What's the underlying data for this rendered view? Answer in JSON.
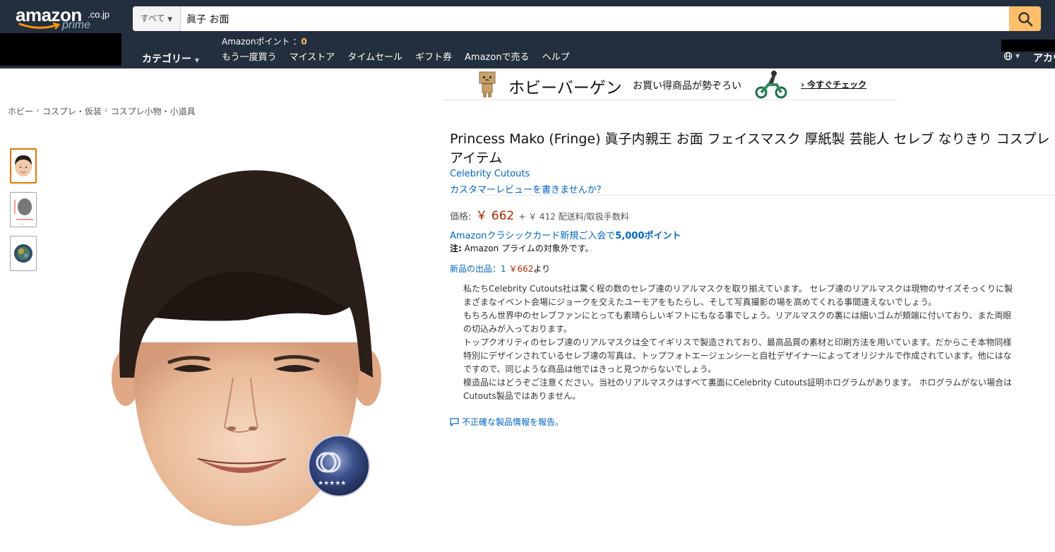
{
  "header": {
    "logo_text": "amazon",
    "logo_tld": ".co.jp",
    "logo_prime": "prime",
    "search_category": "すべて",
    "search_value": "眞子 お面",
    "category_label": "カテゴリー",
    "points_label": "Amazonポイント ：",
    "points_value": "0",
    "nav_links": [
      "もう一度買う",
      "マイストア",
      "タイムセール",
      "ギフト券",
      "Amazonで売る",
      "ヘルプ"
    ],
    "account_label": "アカウ"
  },
  "banner": {
    "title": "ホビーバーゲン",
    "subtitle": "お買い得商品が勢ぞろい",
    "link": "今すぐチェック"
  },
  "breadcrumb": [
    "ホビー",
    "コスプレ・仮装",
    "コスプレ小物・小道具"
  ],
  "product": {
    "title": "Princess Mako (Fringe) 眞子内親王 お面 フェイスマスク 厚紙製 芸能人 セレブ なりきり コスプレ アイテム",
    "brand": "Celebrity Cutouts",
    "review_link": "カスタマーレビューを書きませんか？",
    "price_label": "価格:",
    "price": "￥ 662",
    "shipping": "+ ￥ 412 配送料/取扱手数料",
    "card_promo_prefix": "Amazonクラシックカード新規ご入会で",
    "card_promo_points": "5,000ポイント",
    "prime_note_label": "注:",
    "prime_note_text": "Amazon プライムの対象外です。",
    "offers_label": "新品の出品：1",
    "offers_price": "￥662",
    "offers_suffix": "より",
    "bullets": [
      "私たちCelebrity Cutouts社は驚く程の数のセレブ達のリアルマスクを取り揃えています。 セレブ達のリアルマスクは現物のサイズそっくりに製",
      "まざまなイベント会場にジョークを交えたユーモアをもたらし、そして写真撮影の場を高めてくれる事間違えないでしょう。",
      "もちろん世界中のセレブファンにとっても素晴らしいギフトにもなる事でしょう。リアルマスクの裏には細いゴムが頬端に付いており、また両眼",
      "の切込みが入っております。",
      "トップクオリティのセレブ達のリアルマスクは全てイギリスで製造されており、最高品質の素材と印刷方法を用いています。だからこそ本物同様",
      "特別にデザインされているセレブ達の写真は、トップフォトエージェンシーと自社デザイナーによってオリジナルで作成されています。他にはな",
      "ですので、同じような商品は他ではきっと見つからないでしょう。",
      "模造品にはどうぞご注意ください。当社のリアルマスクはすべて裏面にCelebrity Cutouts証明ホログラムがあります。 ホログラムがない場合は",
      "Cutouts製品ではありません。"
    ],
    "report_link": "不正確な製品情報を報告。"
  },
  "colors": {
    "header_bg": "#232f3e",
    "search_button": "#febd69",
    "link": "#0066c0",
    "price": "#b12704",
    "thumb_active": "#e77600"
  },
  "icons": {
    "search": "search-icon",
    "globe": "globe-icon",
    "report": "comment-icon"
  }
}
